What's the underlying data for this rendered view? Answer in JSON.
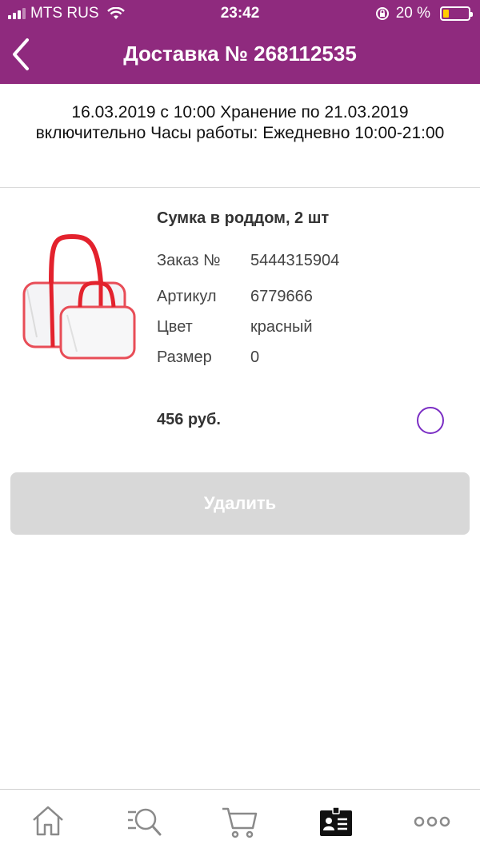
{
  "status_bar": {
    "carrier": "MTS RUS",
    "time": "23:42",
    "battery_percent": "20 %",
    "battery_level": 0.2
  },
  "header": {
    "title": "Доставка № 268112535"
  },
  "info": {
    "text": "16.03.2019 с 10:00 Хранение по 21.03.2019 включительно Часы работы: Ежедневно 10:00-21:00"
  },
  "product": {
    "name": "Сумка в роддом, 2 шт",
    "details": [
      {
        "label": "Заказ №",
        "value": "5444315904"
      },
      {
        "label": "Артикул",
        "value": "6779666"
      },
      {
        "label": "Цвет",
        "value": "красный"
      },
      {
        "label": "Размер",
        "value": "0"
      }
    ],
    "price": "456 руб.",
    "selected": false
  },
  "actions": {
    "delete_label": "Удалить"
  },
  "tabbar": {
    "items": [
      "home-icon",
      "catalog-search-icon",
      "cart-icon",
      "profile-card-icon",
      "more-icon"
    ],
    "active": "profile-card-icon"
  },
  "colors": {
    "header_bg": "#8f2a7e",
    "radio_accent": "#7b2ec4",
    "button_disabled": "#d8d8d8"
  }
}
